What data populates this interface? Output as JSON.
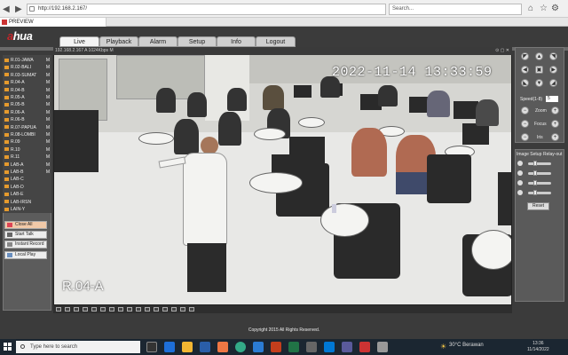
{
  "browser": {
    "url": "http://192.168.2.167/",
    "search_placeholder": "Search...",
    "tab_title": "PREVIEW"
  },
  "app": {
    "logo_text": "alhua",
    "logo_prefix": "a",
    "nav": [
      "Live",
      "Playback",
      "Alarm",
      "Setup",
      "Info",
      "Logout"
    ],
    "active_nav": "Live"
  },
  "cameras": [
    {
      "name": "R.01-JAWA",
      "flag": "M"
    },
    {
      "name": "R.02-BALI",
      "flag": "M"
    },
    {
      "name": "R.03-SUMAT",
      "flag": "M"
    },
    {
      "name": "R.04-A",
      "flag": "M"
    },
    {
      "name": "R.04-B",
      "flag": "M"
    },
    {
      "name": "R.05-A",
      "flag": "M"
    },
    {
      "name": "R.05-B",
      "flag": "M"
    },
    {
      "name": "R.06-A",
      "flag": "M"
    },
    {
      "name": "R.06-B",
      "flag": "M"
    },
    {
      "name": "R.07-PAPUA",
      "flag": "M"
    },
    {
      "name": "R.08-LOMBI",
      "flag": "M"
    },
    {
      "name": "R.09",
      "flag": "M"
    },
    {
      "name": "R.10",
      "flag": "M"
    },
    {
      "name": "R.11",
      "flag": "M"
    },
    {
      "name": "LAB-A",
      "flag": "M"
    },
    {
      "name": "LAB-B",
      "flag": "M"
    },
    {
      "name": "LAB-C",
      "flag": ""
    },
    {
      "name": "LAB-D",
      "flag": ""
    },
    {
      "name": "LAB-E",
      "flag": ""
    },
    {
      "name": "LAB-IRSN",
      "flag": ""
    },
    {
      "name": "LAIN-Y",
      "flag": ""
    }
  ],
  "left_buttons": {
    "close_all": "Close All",
    "start_talk": "Start Talk",
    "instant_record": "Instant Record",
    "local_play": "Local Play"
  },
  "video": {
    "header": "192.168.2.167 A 1024Kbps M",
    "timestamp": "2022-11-14 13:33:59",
    "camera_label": "R.04-A"
  },
  "ptz": {
    "speed_label": "Speed(1-8)",
    "speed_value": "5",
    "zoom_label": "Zoom",
    "focus_label": "Focus",
    "iris_label": "Iris"
  },
  "image_setup": {
    "tab1": "Image Setup",
    "tab2": "Relay-out",
    "reset_label": "Reset",
    "sliders": [
      0.3,
      0.3,
      0.3,
      0.3
    ]
  },
  "footer": {
    "copyright": "Copyright 2015 All Rights Reserved."
  },
  "taskbar": {
    "search_placeholder": "Type here to search",
    "weather": "30°C  Berawan",
    "time": "13:36",
    "date": "11/14/2022"
  },
  "colors": {
    "brand_red": "#c3262a",
    "cam_icon": "#e59a2d"
  }
}
